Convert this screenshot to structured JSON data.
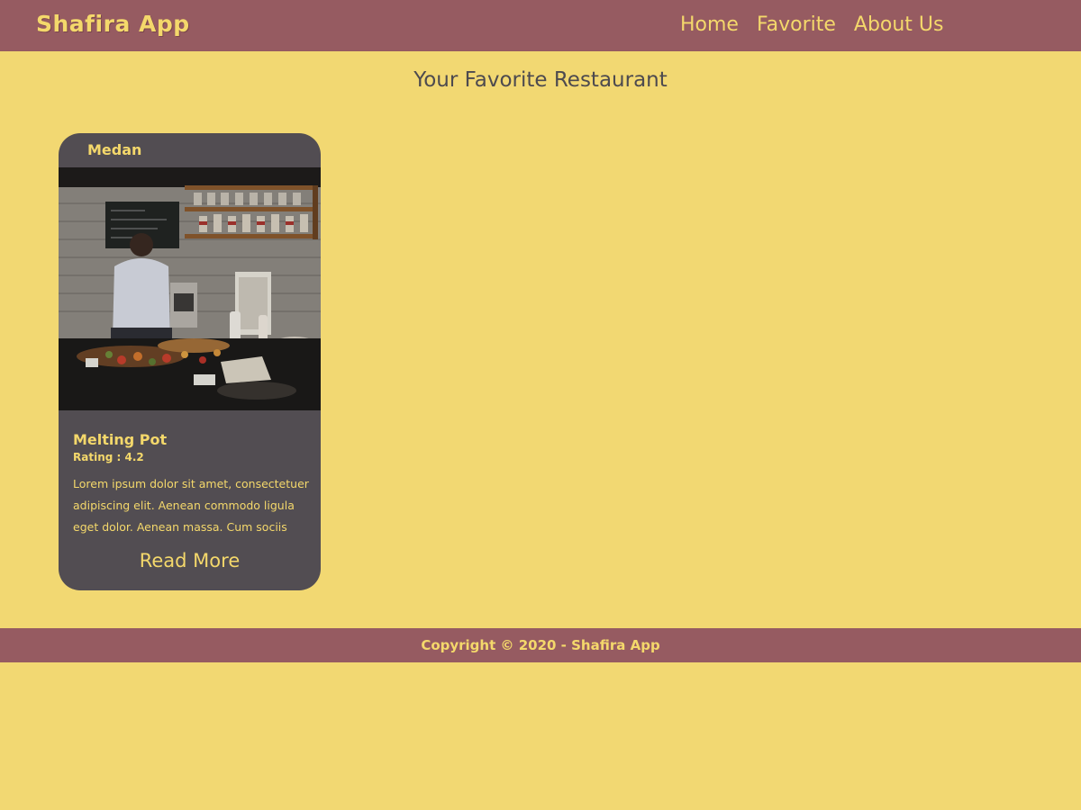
{
  "header": {
    "logo": "Shafira App",
    "nav": [
      "Home",
      "Favorite",
      "About Us"
    ]
  },
  "main": {
    "title": "Your Favorite Restaurant",
    "restaurants": [
      {
        "city": "Medan",
        "name": "Melting Pot",
        "rating": "Rating : 4.2",
        "description": "Lorem ipsum dolor sit amet, consectetuer adipiscing elit. Aenean commodo ligula eget dolor. Aenean massa. Cum sociis",
        "read_more": "Read More"
      }
    ]
  },
  "footer": {
    "copyright": "Copyright © 2020 - Shafira App"
  },
  "colors": {
    "background": "#f2d872",
    "bar": "#965b61",
    "card": "#524d52",
    "accent_text": "#f4d86b",
    "title_text": "#4d4a4f"
  }
}
